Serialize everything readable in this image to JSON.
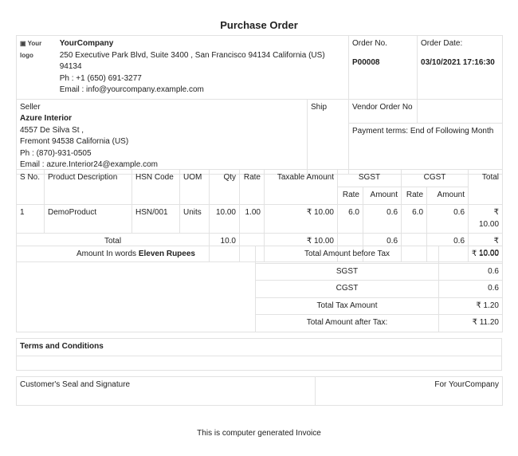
{
  "title": "Purchase Order",
  "company": {
    "logo": "Your logo",
    "name": "YourCompany",
    "address": "250 Executive Park Blvd, Suite 3400 , San Francisco 94134 California (US) 94134",
    "phone": "Ph : +1 (650) 691-3277",
    "email": "Email : info@yourcompany.example.com"
  },
  "order": {
    "no_label": "Order No.",
    "no": "P00008",
    "date_label": "Order Date:",
    "date": "03/10/2021 17:16:30",
    "vendor_label": "Vendor Order No",
    "payment_terms": "Payment terms: End of Following Month"
  },
  "seller": {
    "label": "Seller",
    "name": "Azure Interior",
    "street": "4557 De Silva St ,",
    "city": "Fremont 94538 California (US)",
    "phone": "Ph : (870)-931-0505",
    "email": "Email : azure.Interior24@example.com"
  },
  "ship_label": "Ship",
  "items": {
    "headers": {
      "sno": "S No.",
      "desc": "Product Description",
      "hsn": "HSN Code",
      "uom": "UOM",
      "qty": "Qty",
      "rate": "Rate",
      "taxable": "Taxable Amount",
      "sgst": "SGST",
      "cgst": "CGST",
      "total": "Total",
      "sub_rate": "Rate",
      "sub_amount": "Amount"
    },
    "rows": [
      {
        "sno": "1",
        "desc": "DemoProduct",
        "hsn": "HSN/001",
        "uom": "Units",
        "qty": "10.00",
        "rate": "1.00",
        "taxable": "₹ 10.00",
        "sgst_rate": "6.0",
        "sgst_amt": "0.6",
        "cgst_rate": "6.0",
        "cgst_amt": "0.6",
        "total": "₹ 10.00"
      }
    ],
    "total": {
      "label": "Total",
      "qty": "10.0",
      "taxable": "₹ 10.00",
      "sgst_amt": "0.6",
      "cgst_amt": "0.6",
      "total": "₹ 10.00"
    }
  },
  "summary": {
    "words_label": "Amount In words",
    "words": "Eleven Rupees",
    "rows": [
      {
        "label": "Total Amount before Tax",
        "value": "₹ 10.00"
      },
      {
        "label": "SGST",
        "value": "0.6"
      },
      {
        "label": "CGST",
        "value": "0.6"
      },
      {
        "label": "Total Tax Amount",
        "value": "₹ 1.20"
      },
      {
        "label": "Total Amount after Tax:",
        "value": "₹ 11.20"
      }
    ]
  },
  "terms_label": "Terms and Conditions",
  "signature": {
    "customer": "Customer's Seal and Signature",
    "company": "For YourCompany"
  },
  "footer": "This is computer generated Invoice"
}
